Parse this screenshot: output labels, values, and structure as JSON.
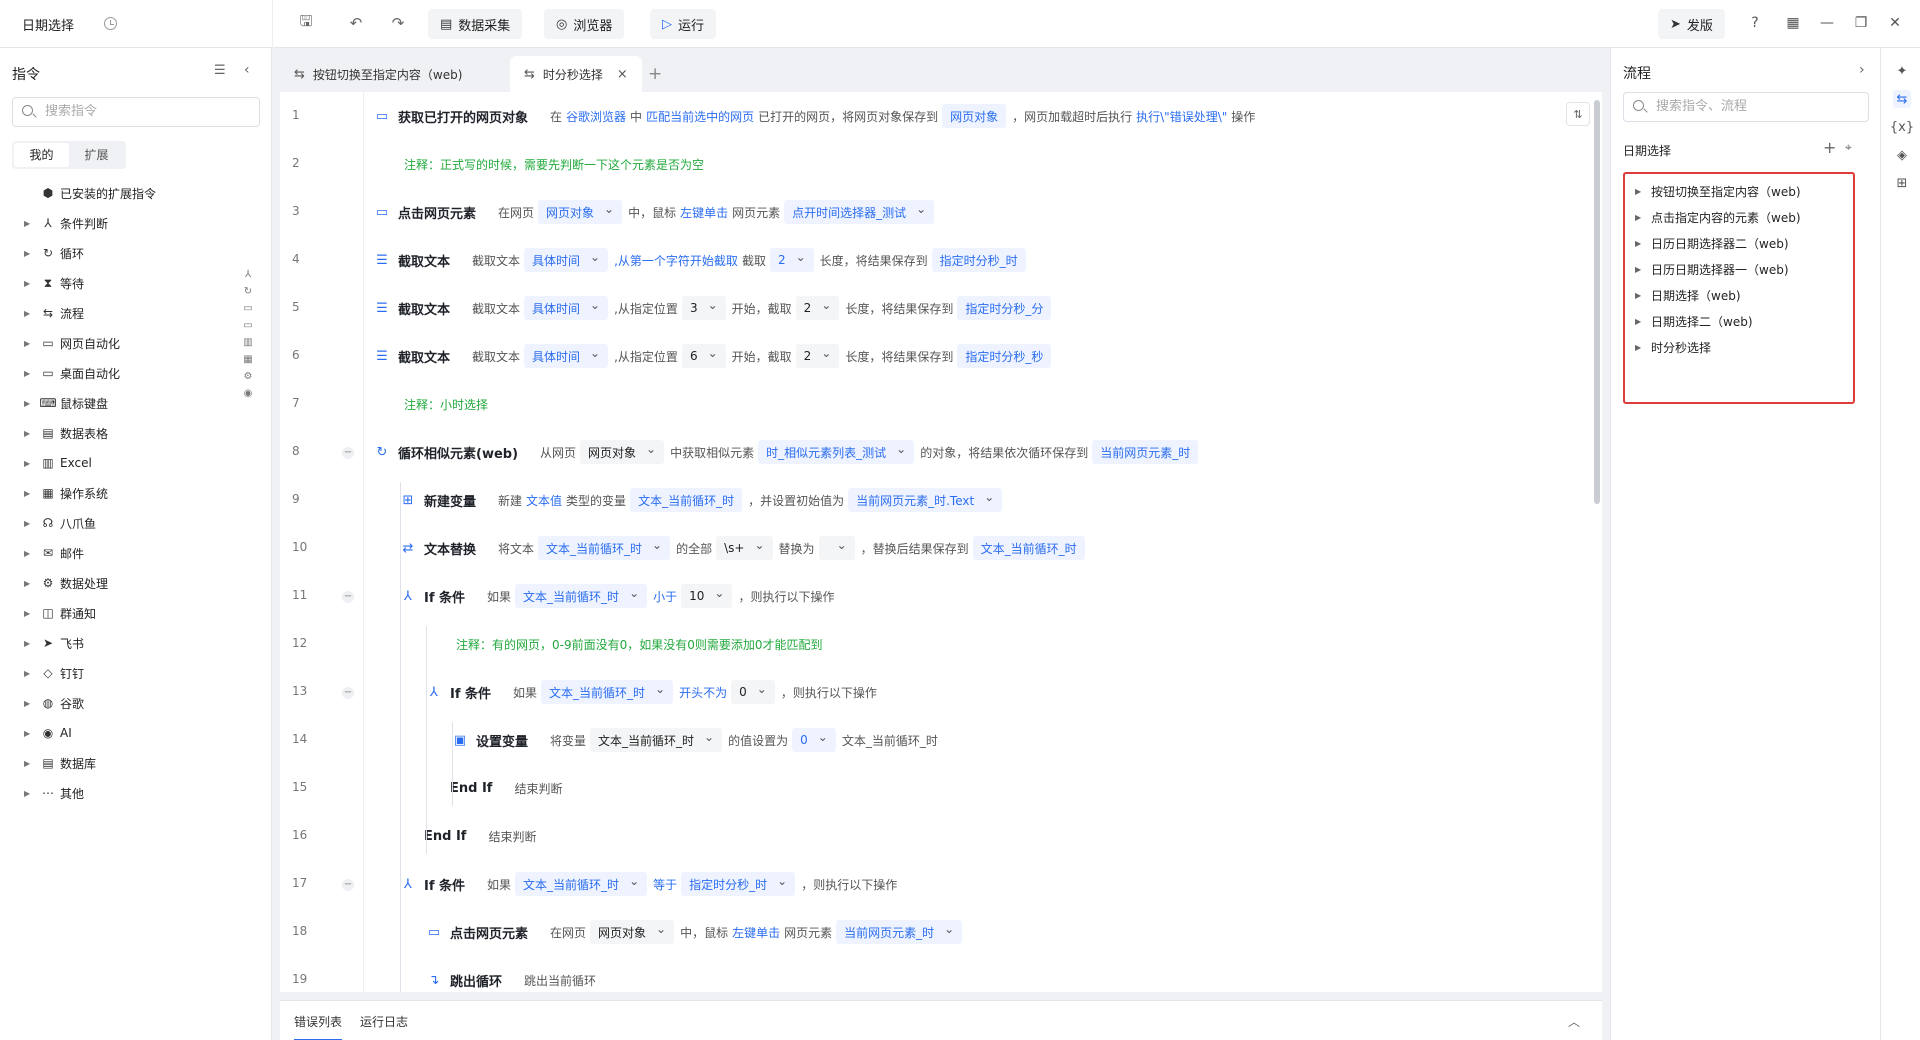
{
  "app": {
    "title": "日期选择"
  },
  "toolbar": {
    "data_collect": "数据采集",
    "browser": "浏览器",
    "run": "运行",
    "publish": "发版"
  },
  "left_panel": {
    "title": "指令",
    "search_placeholder": "搜索指令",
    "tabs": [
      "我的",
      "扩展"
    ],
    "installed": "已安装的扩展指令",
    "items": [
      {
        "label": "条件判断",
        "icon": "branch-icon"
      },
      {
        "label": "循环",
        "icon": "loop-icon"
      },
      {
        "label": "等待",
        "icon": "hourglass-icon"
      },
      {
        "label": "流程",
        "icon": "flow-icon"
      },
      {
        "label": "网页自动化",
        "icon": "web-icon"
      },
      {
        "label": "桌面自动化",
        "icon": "desktop-icon"
      },
      {
        "label": "鼠标键盘",
        "icon": "keyboard-icon"
      },
      {
        "label": "数据表格",
        "icon": "table-icon"
      },
      {
        "label": "Excel",
        "icon": "excel-icon"
      },
      {
        "label": "操作系统",
        "icon": "os-icon"
      },
      {
        "label": "八爪鱼",
        "icon": "octopus-icon"
      },
      {
        "label": "邮件",
        "icon": "mail-icon"
      },
      {
        "label": "数据处理",
        "icon": "data-process-icon"
      },
      {
        "label": "群通知",
        "icon": "group-notify-icon"
      },
      {
        "label": "飞书",
        "icon": "feishu-icon"
      },
      {
        "label": "钉钉",
        "icon": "dingtalk-icon"
      },
      {
        "label": "谷歌",
        "icon": "google-icon"
      },
      {
        "label": "AI",
        "icon": "ai-icon"
      },
      {
        "label": "数据库",
        "icon": "database-icon"
      },
      {
        "label": "其他",
        "icon": "more-icon"
      }
    ]
  },
  "tabs": [
    {
      "label": "按钮切换至指定内容（web)"
    },
    {
      "label": "时分秒选择"
    }
  ],
  "editor": {
    "lines": [
      {
        "n": "1",
        "name": "获取已打开的网页对象",
        "parts": [
          "在",
          "谷歌浏览器",
          "中",
          "匹配当前选中的网页",
          "已打开的网页，将网页对象保存到",
          "网页对象",
          "，网页加载超时后执行",
          "执行\\\"错误处理\\\"",
          "操作"
        ]
      },
      {
        "n": "2",
        "note": "注释：正式写的时候，需要先判断一下这个元素是否为空"
      },
      {
        "n": "3",
        "name": "点击网页元素",
        "parts": [
          "在网页",
          "网页对象",
          "中，鼠标",
          "左键单击",
          "网页元素",
          "点开时间选择器_测试"
        ]
      },
      {
        "n": "4",
        "name": "截取文本",
        "parts": [
          "截取文本",
          "具体时间",
          ",从第一个字符开始截取",
          "截取",
          "2",
          "长度，将结果保存到",
          "指定时分秒_时"
        ]
      },
      {
        "n": "5",
        "name": "截取文本",
        "parts": [
          "截取文本",
          "具体时间",
          ",从指定位置",
          "3",
          "开始，截取",
          "2",
          "长度，将结果保存到",
          "指定时分秒_分"
        ]
      },
      {
        "n": "6",
        "name": "截取文本",
        "parts": [
          "截取文本",
          "具体时间",
          ",从指定位置",
          "6",
          "开始，截取",
          "2",
          "长度，将结果保存到",
          "指定时分秒_秒"
        ]
      },
      {
        "n": "7",
        "note": "注释：小时选择"
      },
      {
        "n": "8",
        "name": "循环相似元素(web)",
        "parts": [
          "从网页",
          "网页对象",
          "中获取相似元素",
          "时_相似元素列表_测试",
          "的对象，将结果依次循环保存到",
          "当前网页元素_时"
        ]
      },
      {
        "n": "9",
        "name": "新建变量",
        "parts": [
          "新建",
          "文本值",
          "类型的变量",
          "文本_当前循环_时",
          "，并设置初始值为",
          "当前网页元素_时.Text"
        ]
      },
      {
        "n": "10",
        "name": "文本替换",
        "parts": [
          "将文本",
          "文本_当前循环_时",
          "的全部",
          "\\s+",
          "替换为",
          "",
          "，替换后结果保存到",
          "文本_当前循环_时"
        ]
      },
      {
        "n": "11",
        "name": "If 条件",
        "parts": [
          "如果",
          "文本_当前循环_时",
          "小于",
          "10",
          "，则执行以下操作"
        ]
      },
      {
        "n": "12",
        "note": "注释：有的网页，0-9前面没有0，如果没有0则需要添加0才能匹配到"
      },
      {
        "n": "13",
        "name": "If 条件",
        "parts": [
          "如果",
          "文本_当前循环_时",
          "开头不为",
          "0",
          "，则执行以下操作"
        ]
      },
      {
        "n": "14",
        "name": "设置变量",
        "parts": [
          "将变量",
          "文本_当前循环_时",
          "的值设置为",
          "0",
          "文本_当前循环_时"
        ]
      },
      {
        "n": "15",
        "name": "End If",
        "parts": [
          "结束判断"
        ]
      },
      {
        "n": "16",
        "name": "End If",
        "parts": [
          "结束判断"
        ]
      },
      {
        "n": "17",
        "name": "If 条件",
        "parts": [
          "如果",
          "文本_当前循环_时",
          "等于",
          "指定时分秒_时",
          "，则执行以下操作"
        ]
      },
      {
        "n": "18",
        "name": "点击网页元素",
        "parts": [
          "在网页",
          "网页对象",
          "中，鼠标",
          "左键单击",
          "网页元素",
          "当前网页元素_时"
        ]
      },
      {
        "n": "19",
        "name": "跳出循环",
        "parts": [
          "跳出当前循环"
        ]
      }
    ]
  },
  "bottom": {
    "tabs": [
      "错误列表",
      "运行日志"
    ]
  },
  "flow_panel": {
    "title": "流程",
    "search_placeholder": "搜索指令、流程",
    "group": "日期选择",
    "items": [
      "按钮切换至指定内容（web)",
      "点击指定内容的元素（web)",
      "日历日期选择器二（web)",
      "日历日期选择器一（web)",
      "日期选择（web)",
      "日期选择二（web)",
      "时分秒选择"
    ],
    "highlight_color": "#e03b3b"
  },
  "colors": {
    "accent": "#2b6df0",
    "note": "#23a93d"
  }
}
